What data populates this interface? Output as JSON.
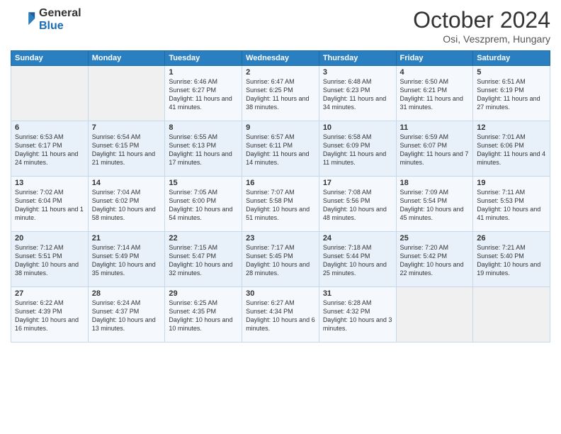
{
  "logo": {
    "general": "General",
    "blue": "Blue"
  },
  "title": "October 2024",
  "location": "Osi, Veszprem, Hungary",
  "weekdays": [
    "Sunday",
    "Monday",
    "Tuesday",
    "Wednesday",
    "Thursday",
    "Friday",
    "Saturday"
  ],
  "weeks": [
    [
      {
        "day": null,
        "content": null
      },
      {
        "day": null,
        "content": null
      },
      {
        "day": "1",
        "content": "Sunrise: 6:46 AM\nSunset: 6:27 PM\nDaylight: 11 hours and 41 minutes."
      },
      {
        "day": "2",
        "content": "Sunrise: 6:47 AM\nSunset: 6:25 PM\nDaylight: 11 hours and 38 minutes."
      },
      {
        "day": "3",
        "content": "Sunrise: 6:48 AM\nSunset: 6:23 PM\nDaylight: 11 hours and 34 minutes."
      },
      {
        "day": "4",
        "content": "Sunrise: 6:50 AM\nSunset: 6:21 PM\nDaylight: 11 hours and 31 minutes."
      },
      {
        "day": "5",
        "content": "Sunrise: 6:51 AM\nSunset: 6:19 PM\nDaylight: 11 hours and 27 minutes."
      }
    ],
    [
      {
        "day": "6",
        "content": "Sunrise: 6:53 AM\nSunset: 6:17 PM\nDaylight: 11 hours and 24 minutes."
      },
      {
        "day": "7",
        "content": "Sunrise: 6:54 AM\nSunset: 6:15 PM\nDaylight: 11 hours and 21 minutes."
      },
      {
        "day": "8",
        "content": "Sunrise: 6:55 AM\nSunset: 6:13 PM\nDaylight: 11 hours and 17 minutes."
      },
      {
        "day": "9",
        "content": "Sunrise: 6:57 AM\nSunset: 6:11 PM\nDaylight: 11 hours and 14 minutes."
      },
      {
        "day": "10",
        "content": "Sunrise: 6:58 AM\nSunset: 6:09 PM\nDaylight: 11 hours and 11 minutes."
      },
      {
        "day": "11",
        "content": "Sunrise: 6:59 AM\nSunset: 6:07 PM\nDaylight: 11 hours and 7 minutes."
      },
      {
        "day": "12",
        "content": "Sunrise: 7:01 AM\nSunset: 6:06 PM\nDaylight: 11 hours and 4 minutes."
      }
    ],
    [
      {
        "day": "13",
        "content": "Sunrise: 7:02 AM\nSunset: 6:04 PM\nDaylight: 11 hours and 1 minute."
      },
      {
        "day": "14",
        "content": "Sunrise: 7:04 AM\nSunset: 6:02 PM\nDaylight: 10 hours and 58 minutes."
      },
      {
        "day": "15",
        "content": "Sunrise: 7:05 AM\nSunset: 6:00 PM\nDaylight: 10 hours and 54 minutes."
      },
      {
        "day": "16",
        "content": "Sunrise: 7:07 AM\nSunset: 5:58 PM\nDaylight: 10 hours and 51 minutes."
      },
      {
        "day": "17",
        "content": "Sunrise: 7:08 AM\nSunset: 5:56 PM\nDaylight: 10 hours and 48 minutes."
      },
      {
        "day": "18",
        "content": "Sunrise: 7:09 AM\nSunset: 5:54 PM\nDaylight: 10 hours and 45 minutes."
      },
      {
        "day": "19",
        "content": "Sunrise: 7:11 AM\nSunset: 5:53 PM\nDaylight: 10 hours and 41 minutes."
      }
    ],
    [
      {
        "day": "20",
        "content": "Sunrise: 7:12 AM\nSunset: 5:51 PM\nDaylight: 10 hours and 38 minutes."
      },
      {
        "day": "21",
        "content": "Sunrise: 7:14 AM\nSunset: 5:49 PM\nDaylight: 10 hours and 35 minutes."
      },
      {
        "day": "22",
        "content": "Sunrise: 7:15 AM\nSunset: 5:47 PM\nDaylight: 10 hours and 32 minutes."
      },
      {
        "day": "23",
        "content": "Sunrise: 7:17 AM\nSunset: 5:45 PM\nDaylight: 10 hours and 28 minutes."
      },
      {
        "day": "24",
        "content": "Sunrise: 7:18 AM\nSunset: 5:44 PM\nDaylight: 10 hours and 25 minutes."
      },
      {
        "day": "25",
        "content": "Sunrise: 7:20 AM\nSunset: 5:42 PM\nDaylight: 10 hours and 22 minutes."
      },
      {
        "day": "26",
        "content": "Sunrise: 7:21 AM\nSunset: 5:40 PM\nDaylight: 10 hours and 19 minutes."
      }
    ],
    [
      {
        "day": "27",
        "content": "Sunrise: 6:22 AM\nSunset: 4:39 PM\nDaylight: 10 hours and 16 minutes."
      },
      {
        "day": "28",
        "content": "Sunrise: 6:24 AM\nSunset: 4:37 PM\nDaylight: 10 hours and 13 minutes."
      },
      {
        "day": "29",
        "content": "Sunrise: 6:25 AM\nSunset: 4:35 PM\nDaylight: 10 hours and 10 minutes."
      },
      {
        "day": "30",
        "content": "Sunrise: 6:27 AM\nSunset: 4:34 PM\nDaylight: 10 hours and 6 minutes."
      },
      {
        "day": "31",
        "content": "Sunrise: 6:28 AM\nSunset: 4:32 PM\nDaylight: 10 hours and 3 minutes."
      },
      {
        "day": null,
        "content": null
      },
      {
        "day": null,
        "content": null
      }
    ]
  ]
}
